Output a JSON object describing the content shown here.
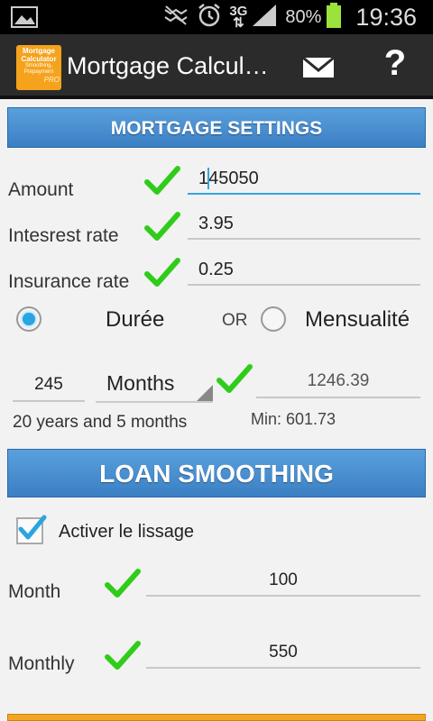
{
  "status_bar": {
    "battery_pct": "80%",
    "time": "19:36",
    "network": "3G"
  },
  "action_bar": {
    "logo_line1": "Mortgage",
    "logo_line2": "Calculator",
    "logo_line3": "Smoothing,",
    "logo_line4": "Prepayment",
    "logo_line5": "PRO",
    "title": "Mortgage Calcul…",
    "help_label": "?"
  },
  "settings": {
    "header": "MORTGAGE SETTINGS",
    "amount_label": "Amount",
    "amount_value": "145050",
    "rate_label": "Intesrest rate",
    "rate_value": "3.95",
    "insurance_label": "Insurance rate",
    "insurance_value": "0.25",
    "duree_label": "Durée",
    "or_label": "OR",
    "mensualite_label": "Mensualité",
    "duration_value": "245",
    "duration_unit": "Months",
    "duration_text": "20 years and 5 months",
    "monthly_payment": "1246.39",
    "min_text": "Min: 601.73"
  },
  "smoothing": {
    "header": "LOAN SMOOTHING",
    "enable_label": "Activer le lissage",
    "month_label": "Month",
    "month_value": "100",
    "monthly_label": "Monthly",
    "monthly_value": "550"
  },
  "colors": {
    "accent": "#33a5d8",
    "header_blue": "#3b7fc4",
    "check_green": "#2fcc1a",
    "logo_orange": "#f5a21c"
  }
}
